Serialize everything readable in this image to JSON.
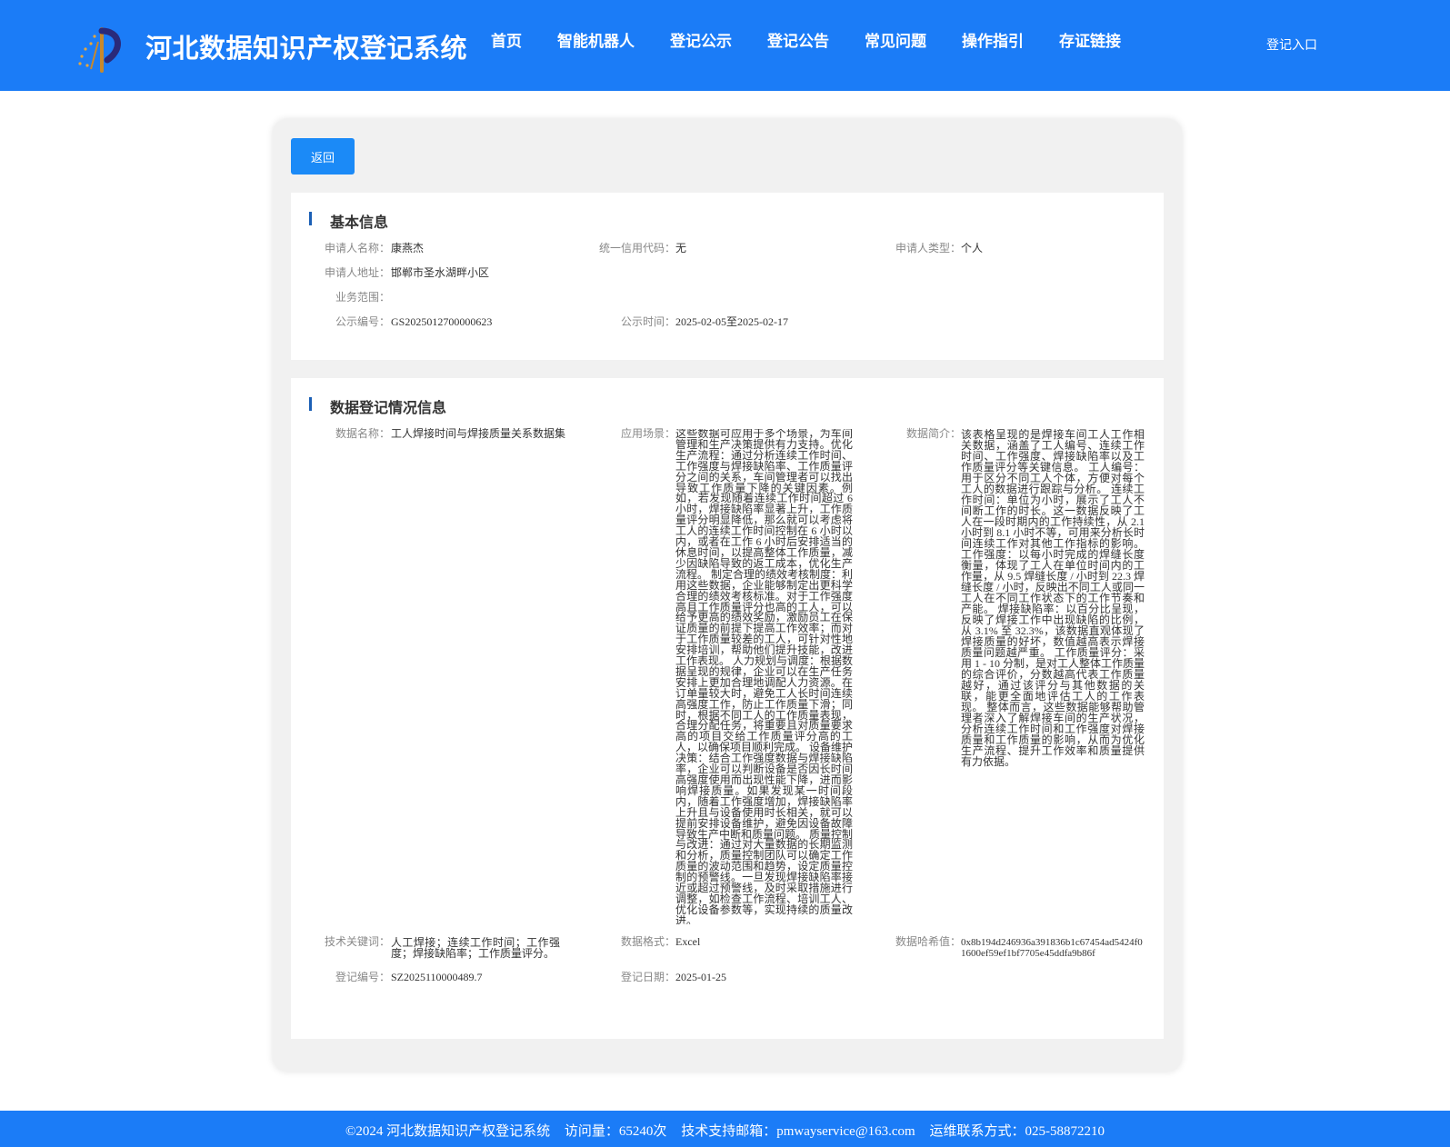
{
  "header": {
    "site_title": "河北数据知识产权登记系统",
    "nav": [
      "首页",
      "智能机器人",
      "登记公示",
      "登记公告",
      "常见问题",
      "操作指引",
      "存证链接"
    ],
    "login": "登记入口",
    "logo_icon": "logo-emblem"
  },
  "colors": {
    "header_bg": "#1b7cf7",
    "button_bg": "#1b8af7",
    "section_bar": "#1b5fb5"
  },
  "back_button": "返回",
  "basic_info": {
    "title": "基本信息",
    "applicant_name_label": "申请人名称：",
    "applicant_name": "康燕杰",
    "credit_code_label": "统一信用代码：",
    "credit_code": "无",
    "applicant_type_label": "申请人类型：",
    "applicant_type": "个人",
    "address_label": "申请人地址：",
    "address": "邯郸市圣水湖畔小区",
    "scope_label": "业务范围：",
    "scope": "",
    "notice_no_label": "公示编号：",
    "notice_no": "GS2025012700000623",
    "notice_time_label": "公示时间：",
    "notice_time": "2025-02-05至2025-02-17"
  },
  "data_info": {
    "title": "数据登记情况信息",
    "name_label": "数据名称：",
    "name": "工人焊接时间与焊接质量关系数据集",
    "scenario_label": "应用场景：",
    "scenario": "这些数据可应用于多个场景，为车间管理和生产决策提供有力支持。优化生产流程：通过分析连续工作时间、工作强度与焊接缺陷率、工作质量评分之间的关系，车间管理者可以找出导致工作质量下降的关键因素。例如，若发现随着连续工作时间超过 6 小时，焊接缺陷率显著上升，工作质量评分明显降低，那么就可以考虑将工人的连续工作时间控制在 6 小时以内，或者在工作 6 小时后安排适当的休息时间，以提高整体工作质量，减少因缺陷导致的返工成本，优化生产流程。 制定合理的绩效考核制度：利用这些数据，企业能够制定出更科学合理的绩效考核标准。对于工作强度高且工作质量评分也高的工人，可以给予更高的绩效奖励，激励员工在保证质量的前提下提高工作效率；而对于工作质量较差的工人，可针对性地安排培训，帮助他们提升技能，改进工作表现。 人力规划与调度：根据数据呈现的规律，企业可以在生产任务安排上更加合理地调配人力资源。在订单量较大时，避免工人长时间连续高强度工作，防止工作质量下滑；同时，根据不同工人的工作质量表现，合理分配任务，将重要且对质量要求高的项目交给工作质量评分高的工人，以确保项目顺利完成。 设备维护决策：结合工作强度数据与焊接缺陷率，企业可以判断设备是否因长时间高强度使用而出现性能下降，进而影响焊接质量。如果发现某一时间段内，随着工作强度增加，焊接缺陷率上升且与设备使用时长相关，就可以提前安排设备维护，避免因设备故障导致生产中断和质量问题。 质量控制与改进：通过对大量数据的长期监测和分析，质量控制团队可以确定工作质量的波动范围和趋势，设定质量控制的预警线。一旦发现焊接缺陷率接近或超过预警线，及时采取措施进行调整，如检查工作流程、培训工人、优化设备参数等，实现持续的质量改进。",
    "intro_label": "数据简介：",
    "intro": "该表格呈现的是焊接车间工人工作相关数据，涵盖了工人编号、连续工作时间、工作强度、焊接缺陷率以及工作质量评分等关键信息。 工人编号：用于区分不同工人个体，方便对每个工人的数据进行跟踪与分析。 连续工作时间：单位为小时，展示了工人不间断工作的时长。这一数据反映了工人在一段时期内的工作持续性，从 2.1 小时到 8.1 小时不等，可用来分析长时间连续工作对其他工作指标的影响。 工作强度：以每小时完成的焊缝长度衡量，体现了工人在单位时间内的工作量，从 9.5 焊缝长度 / 小时到 22.3 焊缝长度 / 小时，反映出不同工人或同一工人在不同工作状态下的工作节奏和产能。 焊接缺陷率：以百分比呈现，反映了焊接工作中出现缺陷的比例，从 3.1% 至 32.3%，该数据直观体现了焊接质量的好坏，数值越高表示焊接质量问题越严重。 工作质量评分：采用 1 - 10 分制，是对工人整体工作质量的综合评价，分数越高代表工作质量越好，通过该评分与其他数据的关联，能更全面地评估工人的工作表现。 整体而言，这些数据能够帮助管理者深入了解焊接车间的生产状况，分析连续工作时间和工作强度对焊接质量和工作质量的影响，从而为优化生产流程、提升工作效率和质量提供有力依据。",
    "keywords_label": "技术关键词：",
    "keywords": "人工焊接；连续工作时间；工作强度；焊接缺陷率；工作质量评分。",
    "format_label": "数据格式：",
    "format": "Excel",
    "hash_label": "数据哈希值：",
    "hash": "0x8b194d246936a391836b1c67454ad5424f01600ef59ef1bf7705e45ddfa9b86f",
    "reg_no_label": "登记编号：",
    "reg_no": "SZ2025110000489.7",
    "reg_date_label": "登记日期：",
    "reg_date": "2025-01-25"
  },
  "footer": {
    "copyright": "©2024 河北数据知识产权登记系统",
    "visits": "访问量：65240次",
    "support": "技术支持邮箱：pmwayservice@163.com",
    "ops": "运维联系方式：025-58872210"
  }
}
